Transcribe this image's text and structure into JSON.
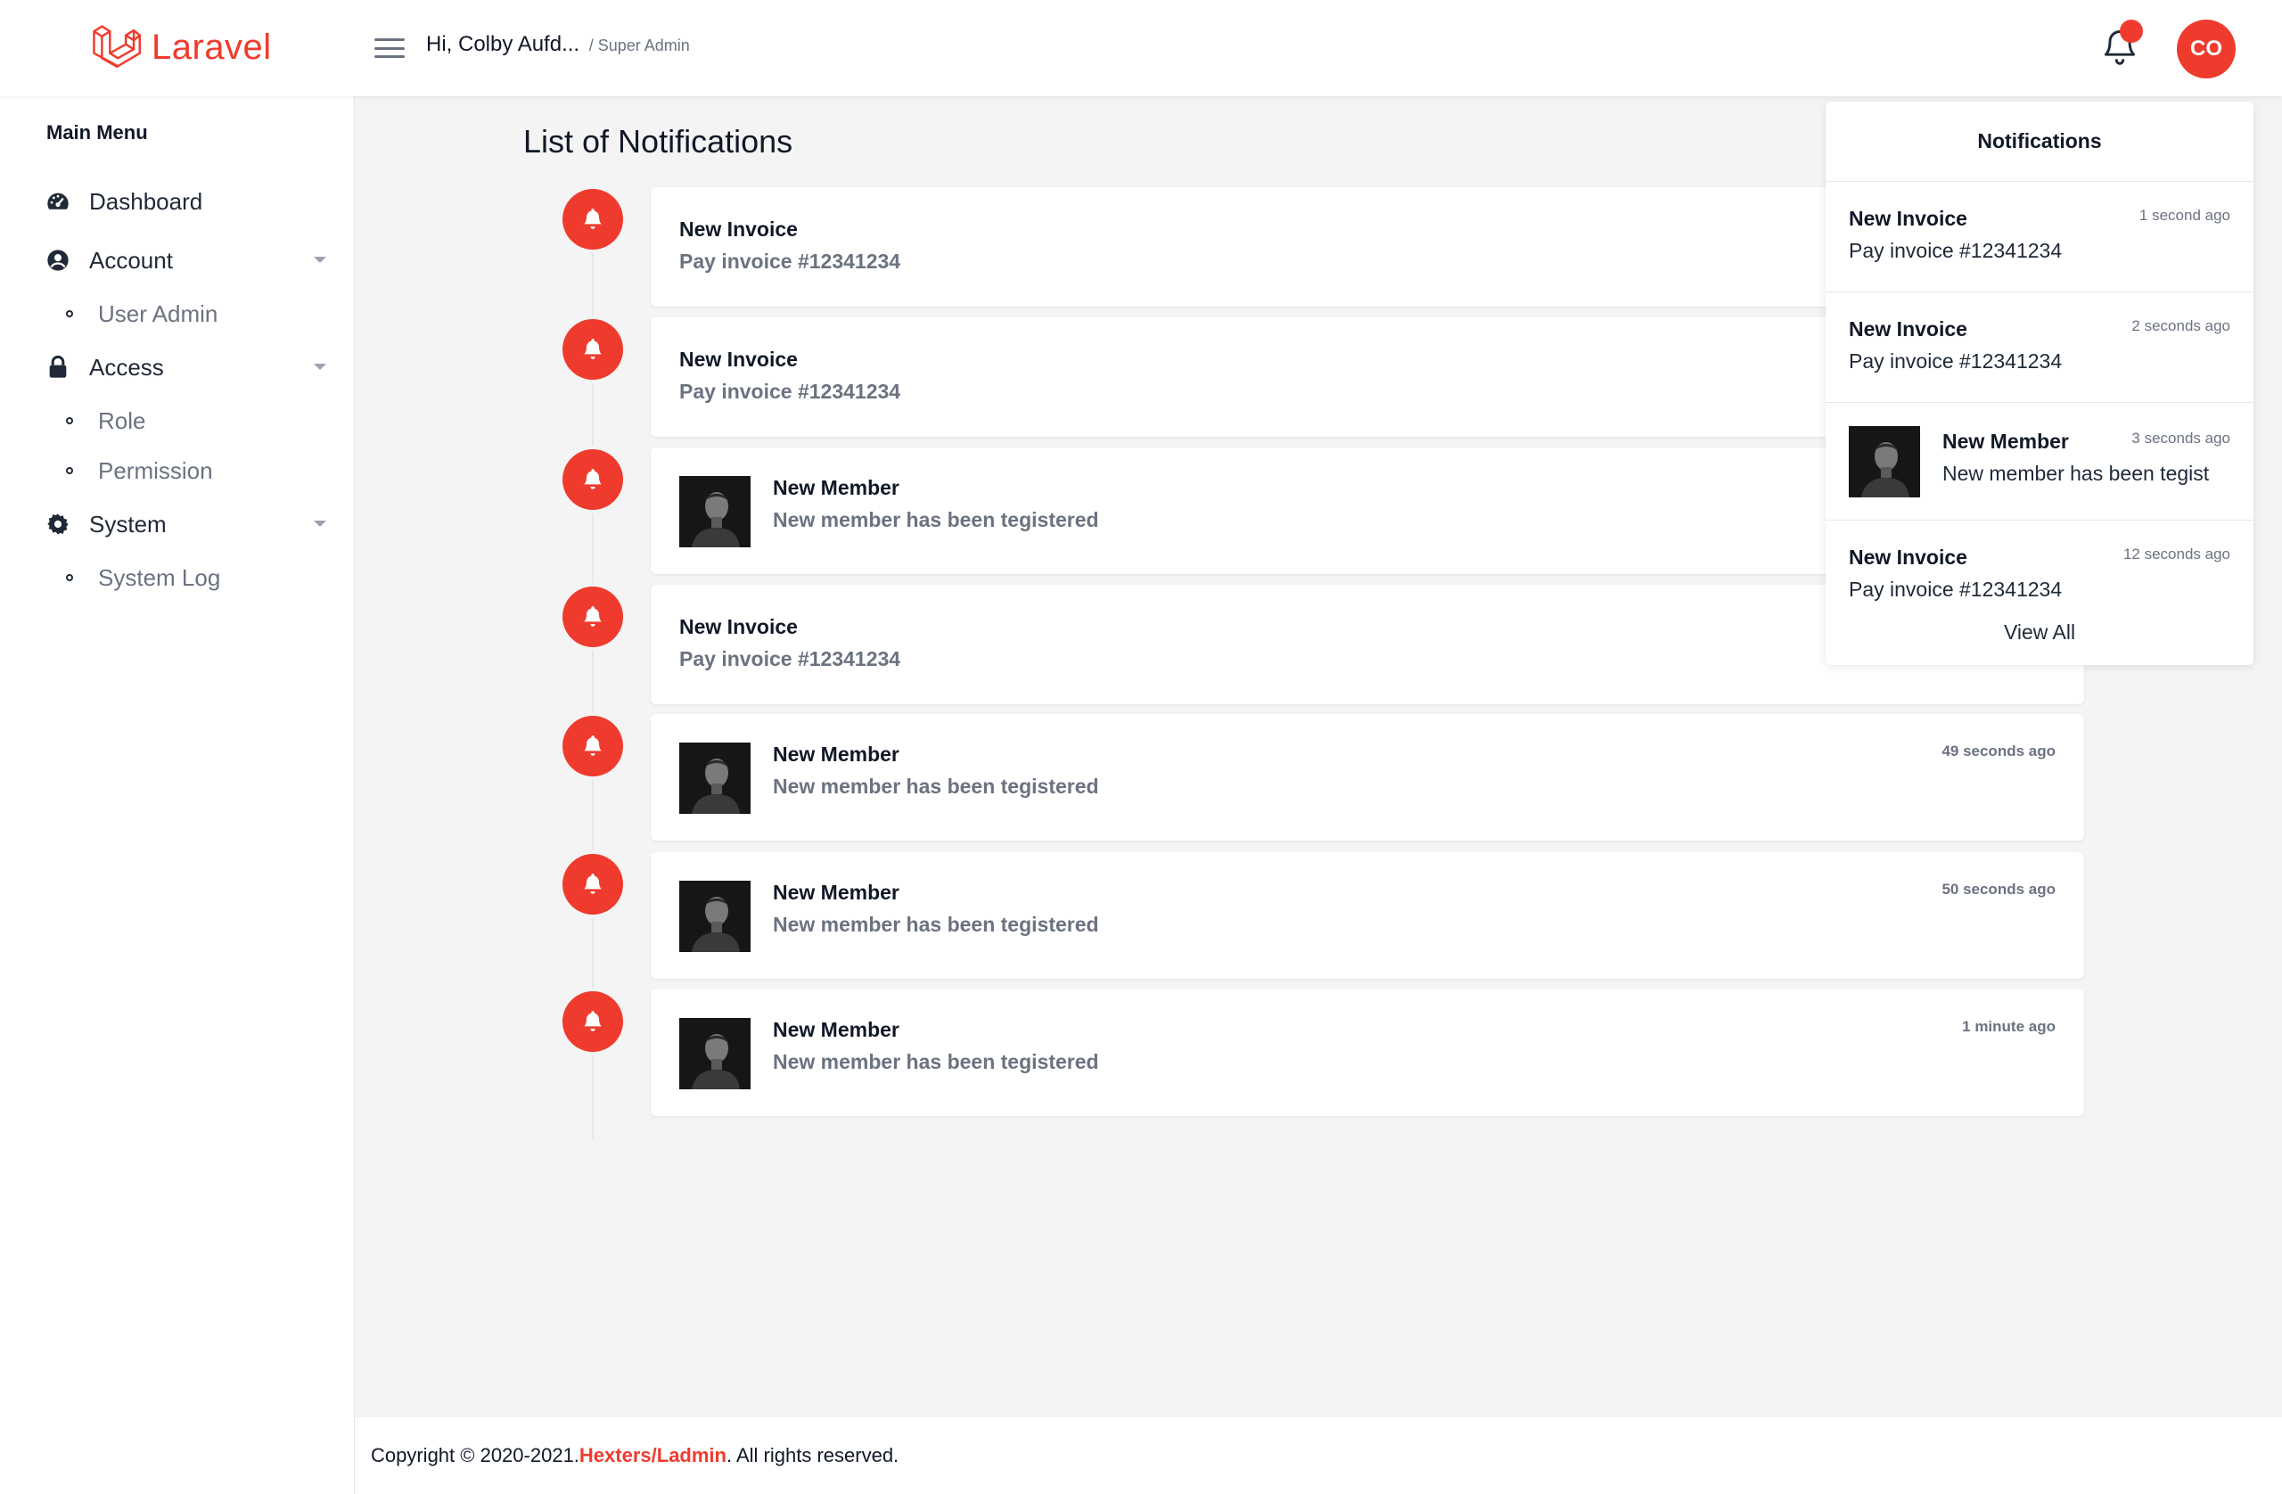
{
  "brand": {
    "name": "Laravel",
    "color": "#ef3b2d"
  },
  "header": {
    "greeting": "Hi, Colby Aufd...",
    "role": "/ Super Admin",
    "avatar_initials": "CO"
  },
  "sidebar": {
    "title": "Main Menu",
    "items": [
      {
        "label": "Dashboard",
        "icon": "dashboard-icon"
      },
      {
        "label": "Account",
        "icon": "user-circle-icon",
        "children": [
          {
            "label": "User Admin"
          }
        ]
      },
      {
        "label": "Access",
        "icon": "lock-icon",
        "children": [
          {
            "label": "Role"
          },
          {
            "label": "Permission"
          }
        ]
      },
      {
        "label": "System",
        "icon": "gear-icon",
        "children": [
          {
            "label": "System Log"
          }
        ]
      }
    ]
  },
  "main": {
    "title": "List of Notifications",
    "notifications": [
      {
        "title": "New Invoice",
        "message": "Pay invoice #12341234",
        "time": "",
        "type": "invoice"
      },
      {
        "title": "New Invoice",
        "message": "Pay invoice #12341234",
        "time": "",
        "type": "invoice"
      },
      {
        "title": "New Member",
        "message": "New member has been tegistered",
        "time": "",
        "type": "member"
      },
      {
        "title": "New Invoice",
        "message": "Pay invoice #12341234",
        "time": "",
        "type": "invoice"
      },
      {
        "title": "New Member",
        "message": "New member has been tegistered",
        "time": "49 seconds ago",
        "type": "member"
      },
      {
        "title": "New Member",
        "message": "New member has been tegistered",
        "time": "50 seconds ago",
        "type": "member"
      },
      {
        "title": "New Member",
        "message": "New member has been tegistered",
        "time": "1 minute ago",
        "type": "member"
      }
    ]
  },
  "dropdown": {
    "title": "Notifications",
    "items": [
      {
        "title": "New Invoice",
        "message": "Pay invoice #12341234",
        "time": "1 second ago",
        "type": "invoice"
      },
      {
        "title": "New Invoice",
        "message": "Pay invoice #12341234",
        "time": "2 seconds ago",
        "type": "invoice"
      },
      {
        "title": "New Member",
        "message": "New member has been tegist",
        "time": "3 seconds ago",
        "type": "member"
      },
      {
        "title": "New Invoice",
        "message": "Pay invoice #12341234",
        "time": "12 seconds ago",
        "type": "invoice"
      }
    ],
    "view_all": "View All"
  },
  "footer": {
    "prefix": "Copyright © 2020-2021. ",
    "link": "Hexters/Ladmin",
    "suffix": ". All rights reserved."
  }
}
